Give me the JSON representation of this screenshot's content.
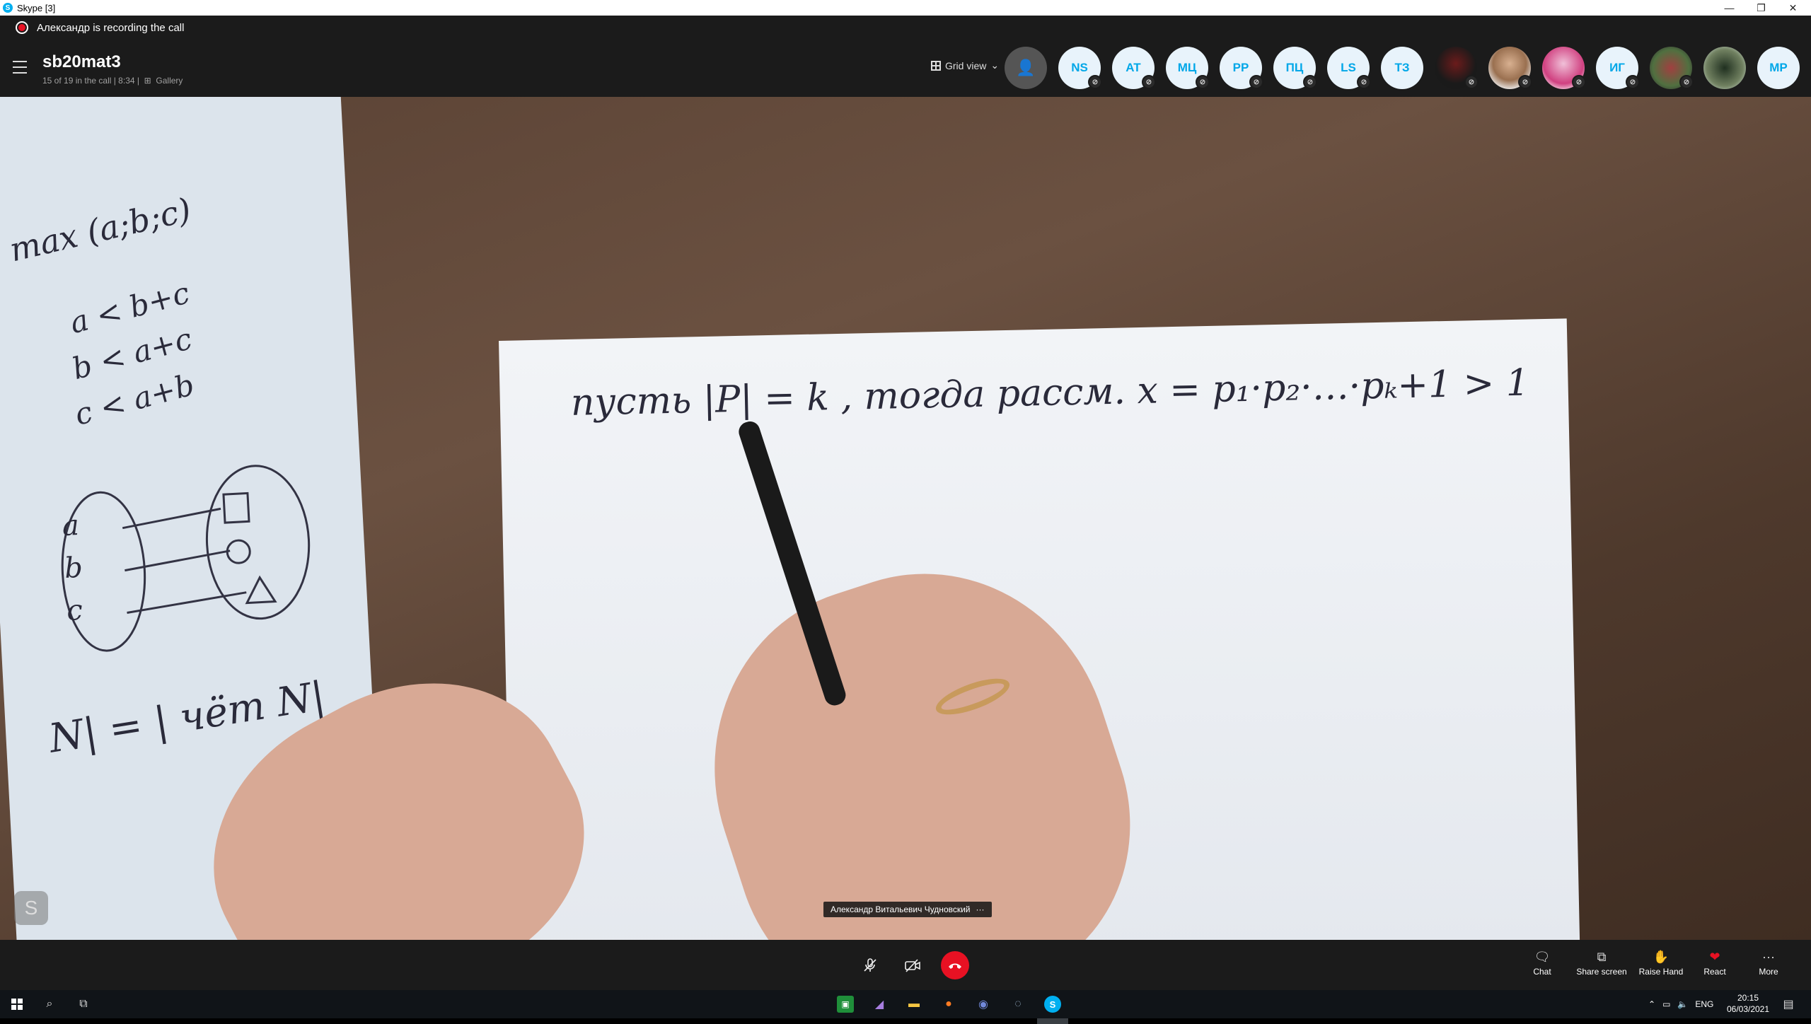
{
  "window": {
    "title": "Skype [3]",
    "controls": {
      "minimize": "—",
      "restore": "❐",
      "close": "✕"
    }
  },
  "recording": {
    "text": "Александр is recording the call",
    "color": "#e81123"
  },
  "call": {
    "name": "sb20mat3",
    "meta": "15 of 19 in the call | 8:34 |",
    "view_mode": "Gallery",
    "grid_view_label": "Grid view"
  },
  "participants": [
    {
      "initials": "NS"
    },
    {
      "initials": "AT"
    },
    {
      "initials": "МЦ"
    },
    {
      "initials": "PP"
    },
    {
      "initials": "ПЦ"
    },
    {
      "initials": "LS"
    },
    {
      "initials": "ТЗ"
    },
    {
      "initials": ""
    },
    {
      "initials": ""
    },
    {
      "initials": ""
    },
    {
      "initials": "ИГ"
    },
    {
      "initials": ""
    },
    {
      "initials": ""
    },
    {
      "initials": "MP"
    }
  ],
  "video": {
    "speaker_name": "Александр Витальевич Чудновский",
    "speaker_more": "···",
    "self_initial": "S",
    "handwriting_main": "пусть  |P| = k ,  тогда  рассм.  x = p₁·p₂·…·pₖ+1 > 1",
    "handwriting_left": {
      "line1": "max (a;b;c)",
      "sys1": "a < b+c",
      "sys2": "b < a+c",
      "sys3": "c < a+b",
      "set_a": "a",
      "set_b": "b",
      "set_c": "c",
      "bottom": "N| = | чёт N|"
    }
  },
  "controls": {
    "mute_icon": "mic-off",
    "video_icon": "video-off",
    "hangup_icon": "hangup",
    "right": [
      {
        "label": "Chat",
        "icon": "🗨"
      },
      {
        "label": "Share screen",
        "icon": "⧉"
      },
      {
        "label": "Raise Hand",
        "icon": "✋"
      },
      {
        "label": "React",
        "icon": "❤"
      },
      {
        "label": "More",
        "icon": "···"
      }
    ]
  },
  "taskbar": {
    "language": "ENG",
    "time": "20:15",
    "date": "06/03/2021"
  }
}
